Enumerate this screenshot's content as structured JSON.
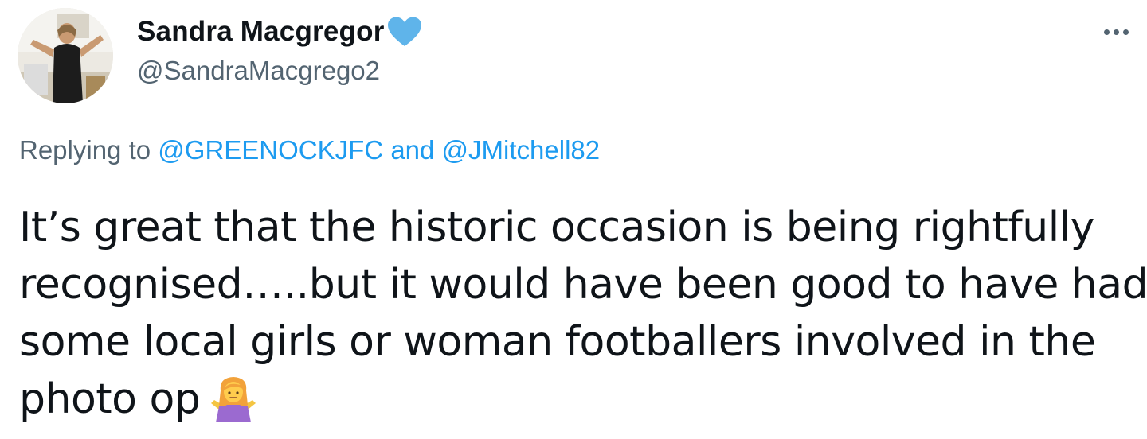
{
  "tweet": {
    "author": {
      "display_name": "Sandra Macgregor",
      "handle": "@SandraMacgrego2",
      "avatar": "user-avatar-photo",
      "badge": "blue-heart-icon"
    },
    "more_icon": "more-options-icon",
    "replying_to": {
      "prefix": "Replying to",
      "mentions": [
        "@GREENOCKJFC",
        "@JMitchell82"
      ],
      "joiner": "and"
    },
    "text_lines": [
      "It’s great that the historic occasion is being rightfully",
      "recognised…..but it would have been good to have had",
      "some local girls or woman footballers involved in the",
      "photo op"
    ],
    "emoji": "woman-shrugging-emoji"
  },
  "colors": {
    "text_primary": "#0f1419",
    "text_secondary": "#536471",
    "link": "#1d9bf0",
    "heart": "#5fb4ea"
  }
}
